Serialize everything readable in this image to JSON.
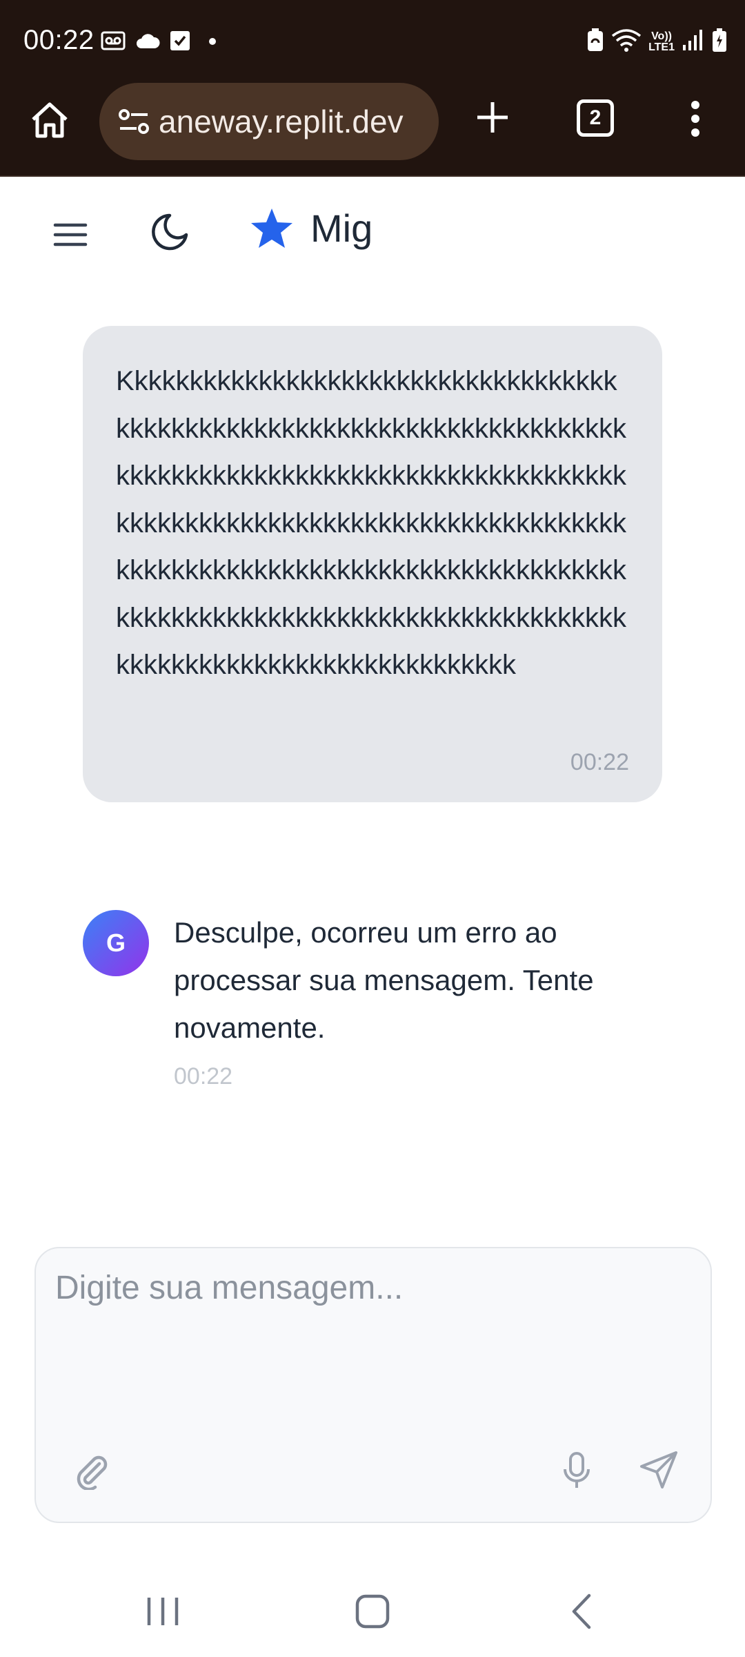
{
  "status_bar": {
    "time": "00:22",
    "left_icons": [
      "voicemail-icon",
      "cloud-icon",
      "checkbox-icon",
      "dot-icon"
    ],
    "right_icons": [
      "battery-saver-icon",
      "wifi-icon",
      "volte-icon",
      "signal-icon",
      "battery-icon"
    ],
    "volte_line1": "Vo))",
    "volte_line2": "LTE1"
  },
  "browser": {
    "url": "aneway.replit.dev",
    "tab_count": "2",
    "colors": {
      "toolbar_bg": "#21140f",
      "urlbar_bg": "#4a3426"
    }
  },
  "app_header": {
    "title": "Mig",
    "brand_icon": "star-icon",
    "accent": "#2563eb"
  },
  "conversation": {
    "user_message": {
      "text": "Kkkkkkkkkkkkkkkkkkkkkkkkkkkkkkkkkkkkkkkkkkkkkkkkkkkkkkkkkkkkkkkkkkkkkkkkkkkkkkkkkkkkkkkkkkkkkkkkkkkkkkkkkkkkkkkkkkkkkkkkkkkkkkkkkkkkkkkkkkkkkkkkkkkkkkkkkkkkkkkkkkkkkkkkkkkkkkkkkkkkkkkkkkkkkkkkkkkkkkkkkkkkkkkkkkkkkkkkkkkkkkkkkkkkkkkkkkkkkkkkkkkkkkkkkk",
      "time": "00:22"
    },
    "assistant_message": {
      "avatar_letter": "G",
      "text": "Desculpe, ocorreu um erro ao processar sua mensagem. Tente novamente.",
      "time": "00:22"
    }
  },
  "composer": {
    "placeholder": "Digite sua mensagem...",
    "value": ""
  }
}
